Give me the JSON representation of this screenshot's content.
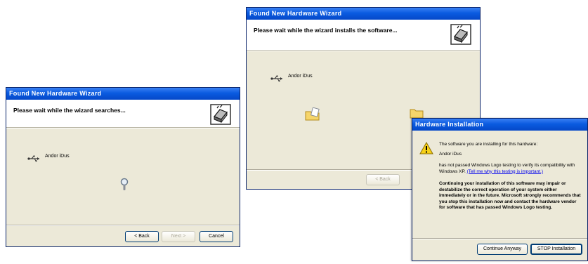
{
  "wizard_left": {
    "title": "Found New Hardware Wizard",
    "header": "Please wait while the wizard searches...",
    "device_name": "Andor iDus",
    "buttons": {
      "back": "< Back",
      "next": "Next >",
      "cancel": "Cancel"
    }
  },
  "wizard_right": {
    "title": "Found New Hardware Wizard",
    "header": "Please wait while the wizard installs the software...",
    "device_name": "Andor iDus",
    "buttons": {
      "back": "< Back"
    }
  },
  "hardware_dialog": {
    "title": "Hardware Installation",
    "line1": "The software you are installing for this hardware:",
    "device_name": "Andor iDus",
    "line2": "has not passed Windows Logo testing to verify its compatibility with Windows XP.",
    "link": "(Tell me why this testing is important.)",
    "warning": "Continuing your installation of this software may impair or destabilize the correct operation of your system either immediately or in the future. Microsoft strongly recommends that you stop this installation now and contact the hardware vendor for software that has passed Windows Logo testing.",
    "buttons": {
      "continue": "Continue Anyway",
      "stop": "STOP Installation"
    }
  },
  "icons": {
    "wizard": "hardware-wizard-icon",
    "usb": "usb-icon",
    "search": "magnifier-icon",
    "copy": "file-copy-animation-icon",
    "warning": "warning-icon"
  },
  "colors": {
    "titlebar": "#0a5be0",
    "dialog_bg": "#ece9d8",
    "header_bg": "#ffffff",
    "link": "#0000ee"
  }
}
